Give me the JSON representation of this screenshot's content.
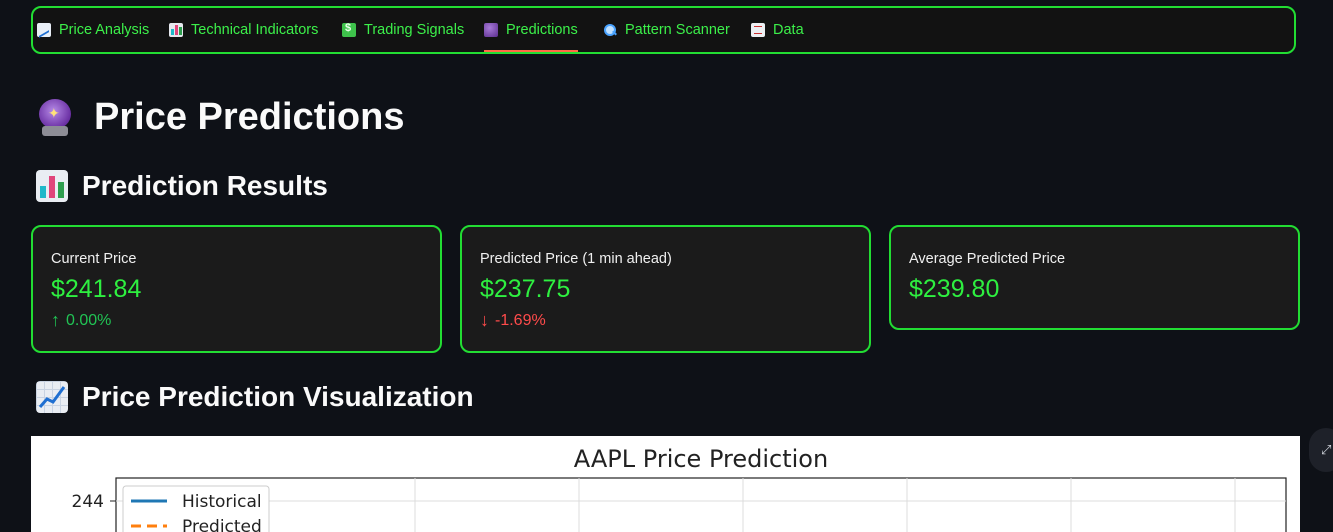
{
  "tabs": [
    {
      "label": "Price Analysis",
      "icon": "chart-increasing-icon"
    },
    {
      "label": "Technical Indicators",
      "icon": "bar-chart-icon"
    },
    {
      "label": "Trading Signals",
      "icon": "money-chart-icon"
    },
    {
      "label": "Predictions",
      "icon": "crystal-ball-icon",
      "active": true
    },
    {
      "label": "Pattern Scanner",
      "icon": "magnifier-icon"
    },
    {
      "label": "Data",
      "icon": "document-icon"
    }
  ],
  "page_title": "Price Predictions",
  "results_heading": "Prediction Results",
  "metrics": [
    {
      "label": "Current Price",
      "value": "$241.84",
      "delta": "0.00%",
      "delta_direction": "up"
    },
    {
      "label": "Predicted Price (1 min ahead)",
      "value": "$237.75",
      "delta": "-1.69%",
      "delta_direction": "down"
    },
    {
      "label": "Average Predicted Price",
      "value": "$239.80"
    }
  ],
  "viz_heading": "Price Prediction Visualization",
  "colors": {
    "accent_border": "#22dd33",
    "metric_value": "#2ef040",
    "delta_up": "#21c354",
    "delta_down": "#ff4b4b",
    "active_tab_underline": "#ff6a45",
    "historical_line": "#1f77b4",
    "predicted_line": "#ff7f0e"
  },
  "chart_data": {
    "type": "line",
    "title": "AAPL Price Prediction",
    "y_tick_labels": [
      "244"
    ],
    "legend_placement": "top-left",
    "series": [
      {
        "name": "Historical",
        "style": "solid"
      },
      {
        "name": "Predicted",
        "style": "dashed"
      }
    ],
    "grid": true
  },
  "fullscreen_icon": "expand-icon"
}
